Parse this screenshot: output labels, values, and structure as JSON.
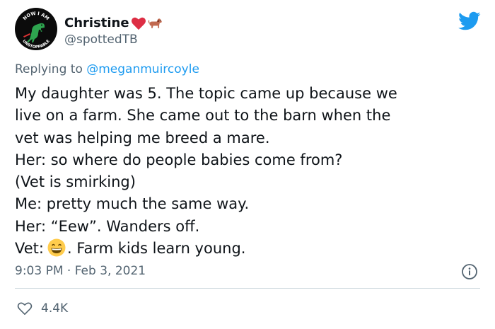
{
  "author": {
    "display_name": "Christine",
    "handle": "@spottedTB",
    "name_emojis": [
      "red-heart-icon",
      "dog-icon"
    ],
    "avatar": {
      "badge_text_top": "NOW I AM",
      "badge_text_bottom": "UNSTOPPABLE",
      "icon": "t-rex-icon"
    }
  },
  "reply": {
    "prefix": "Replying to",
    "mention": "@meganmuircoyle"
  },
  "body": {
    "lines": [
      "My daughter was 5. The topic came up because we",
      "live on a farm. She came out to the barn when the",
      "vet was helping me breed a mare.",
      "Her: so where do people babies come from?",
      "(Vet is smirking)",
      "Me: pretty much the same way.",
      "Her: “Eew”. Wanders off."
    ],
    "last_line_prefix": "Vet:",
    "last_line_suffix": ". Farm kids learn young.",
    "emoji": "grinning-face-icon"
  },
  "meta": {
    "timestamp": "9:03 PM · Feb 3, 2021",
    "like_count": "4.4K"
  },
  "colors": {
    "text": "#0f1419",
    "secondary": "#536471",
    "accent": "#1d9bf0",
    "heart": "#e0245e",
    "divider": "#cfd9de"
  }
}
